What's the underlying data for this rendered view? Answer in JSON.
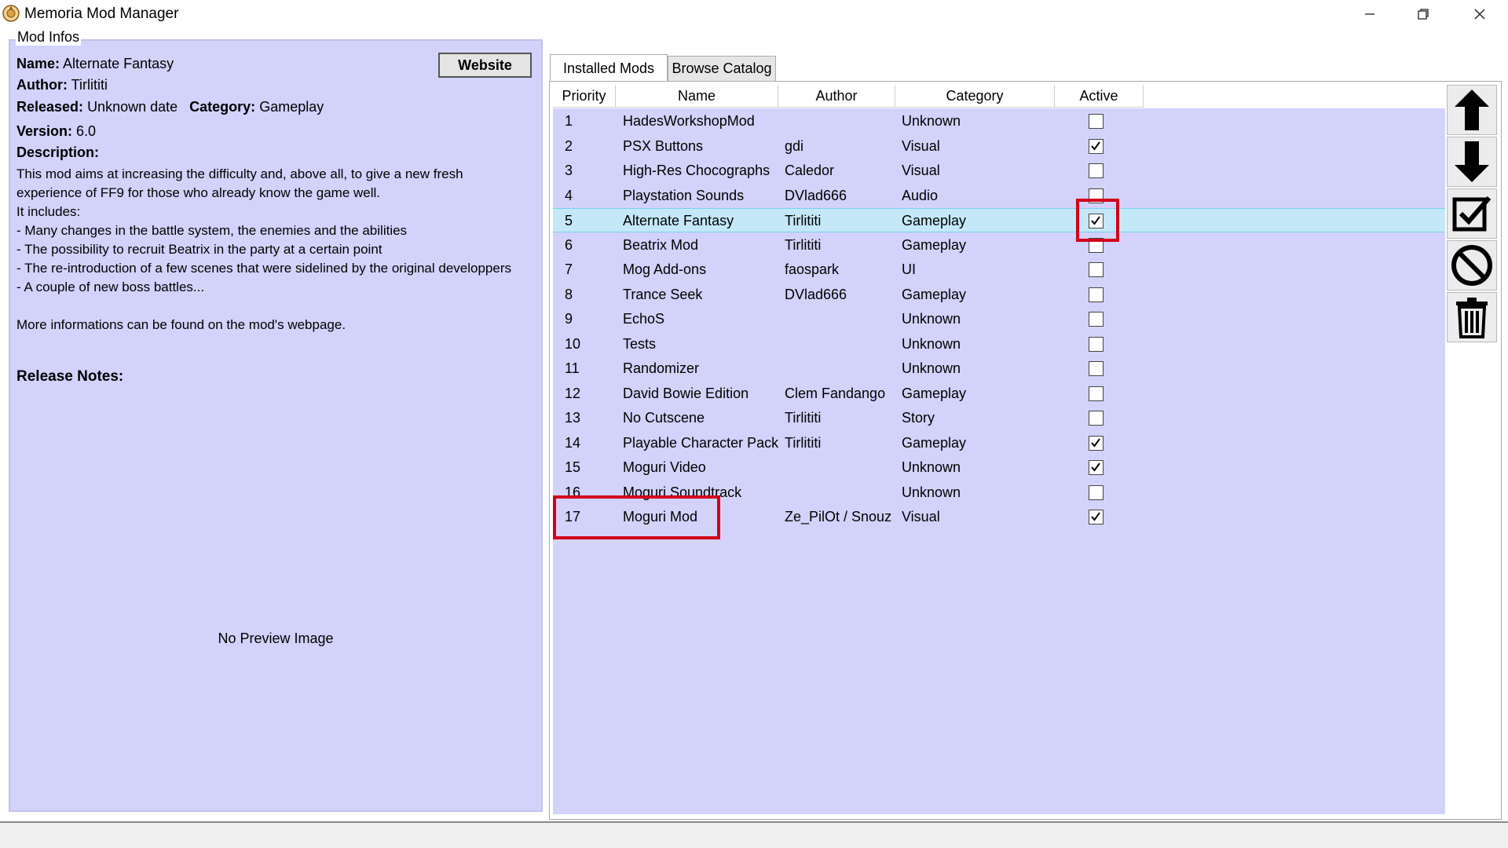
{
  "window": {
    "title": "Memoria Mod Manager"
  },
  "mod_info": {
    "caption": "Mod Infos",
    "name_label": "Name:",
    "name_value": "Alternate Fantasy",
    "author_label": "Author:",
    "author_value": "Tirlititi",
    "released_label": "Released:",
    "released_value": "Unknown date",
    "category_label": "Category:",
    "category_value": "Gameplay",
    "version_label": "Version:",
    "version_value": "6.0",
    "description_label": "Description:",
    "description": "This mod aims at increasing the difficulty and, above all, to give a new fresh experience of FF9 for those who already know the game well.\nIt includes:\n- Many changes in the battle system, the enemies and the abilities\n- The possibility to recruit Beatrix in the party at a certain point\n- The re-introduction of a few scenes that were sidelined by the original developpers\n- A couple of new boss battles...\n\nMore informations can be found on the mod's webpage.",
    "release_notes_label": "Release Notes:",
    "website_button": "Website",
    "no_preview": "No Preview Image"
  },
  "tabs": [
    {
      "label": "Installed Mods",
      "active": true
    },
    {
      "label": "Browse Catalog",
      "active": false
    }
  ],
  "table": {
    "columns": [
      "Priority",
      "Name",
      "Author",
      "Category",
      "Active"
    ],
    "rows": [
      {
        "priority": "1",
        "name": "HadesWorkshopMod",
        "author": "",
        "category": "Unknown",
        "active": false
      },
      {
        "priority": "2",
        "name": "PSX Buttons",
        "author": "gdi",
        "category": "Visual",
        "active": true
      },
      {
        "priority": "3",
        "name": "High-Res Chocographs",
        "author": "Caledor",
        "category": "Visual",
        "active": false
      },
      {
        "priority": "4",
        "name": "Playstation Sounds",
        "author": "DVlad666",
        "category": "Audio",
        "active": false
      },
      {
        "priority": "5",
        "name": "Alternate Fantasy",
        "author": "Tirlititi",
        "category": "Gameplay",
        "active": true,
        "selected": true
      },
      {
        "priority": "6",
        "name": "Beatrix Mod",
        "author": "Tirlititi",
        "category": "Gameplay",
        "active": false
      },
      {
        "priority": "7",
        "name": "Mog Add-ons",
        "author": "faospark",
        "category": "UI",
        "active": false
      },
      {
        "priority": "8",
        "name": "Trance Seek",
        "author": "DVlad666",
        "category": "Gameplay",
        "active": false
      },
      {
        "priority": "9",
        "name": "EchoS",
        "author": "",
        "category": "Unknown",
        "active": false
      },
      {
        "priority": "10",
        "name": "Tests",
        "author": "",
        "category": "Unknown",
        "active": false
      },
      {
        "priority": "11",
        "name": "Randomizer",
        "author": "",
        "category": "Unknown",
        "active": false
      },
      {
        "priority": "12",
        "name": "David Bowie Edition",
        "author": "Clem Fandango",
        "category": "Gameplay",
        "active": false
      },
      {
        "priority": "13",
        "name": "No Cutscene",
        "author": "Tirlititi",
        "category": "Story",
        "active": false
      },
      {
        "priority": "14",
        "name": "Playable Character Pack",
        "author": "Tirlititi",
        "category": "Gameplay",
        "active": true
      },
      {
        "priority": "15",
        "name": "Moguri Video",
        "author": "",
        "category": "Unknown",
        "active": true
      },
      {
        "priority": "16",
        "name": "Moguri Soundtrack",
        "author": "",
        "category": "Unknown",
        "active": false
      },
      {
        "priority": "17",
        "name": "Moguri Mod",
        "author": "Ze_PilOt / Snouz",
        "category": "Visual",
        "active": true
      }
    ]
  },
  "toolbar_icons": [
    "arrow-up-icon",
    "arrow-down-icon",
    "check-all-icon",
    "deactivate-all-icon",
    "trash-icon"
  ],
  "colors": {
    "panel_bg": "#d2d2fa",
    "selected_row": "#c4e8f7",
    "highlight": "#d0021b"
  }
}
